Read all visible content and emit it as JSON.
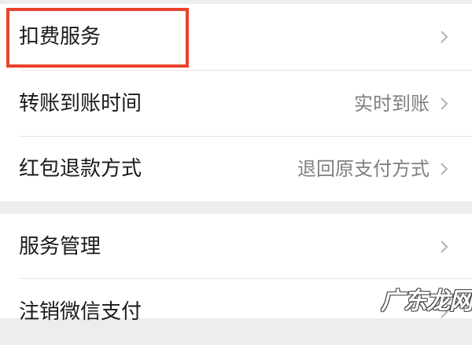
{
  "settings": {
    "group1": [
      {
        "label": "扣费服务",
        "value": ""
      },
      {
        "label": "转账到账时间",
        "value": "实时到账"
      },
      {
        "label": "红包退款方式",
        "value": "退回原支付方式"
      }
    ],
    "group2": [
      {
        "label": "服务管理",
        "value": ""
      },
      {
        "label": "注销微信支付",
        "value": ""
      }
    ]
  },
  "annotation": {
    "highlight_color": "#e8432d"
  },
  "watermark": {
    "text": "广东龙网"
  },
  "icons": {
    "row_chevron": "chevron-right-icon"
  },
  "colors": {
    "background": "#ededed",
    "card": "#ffffff",
    "label": "#1a1a1a",
    "value": "#7f7f7f",
    "chevron": "#b2b2b2"
  }
}
